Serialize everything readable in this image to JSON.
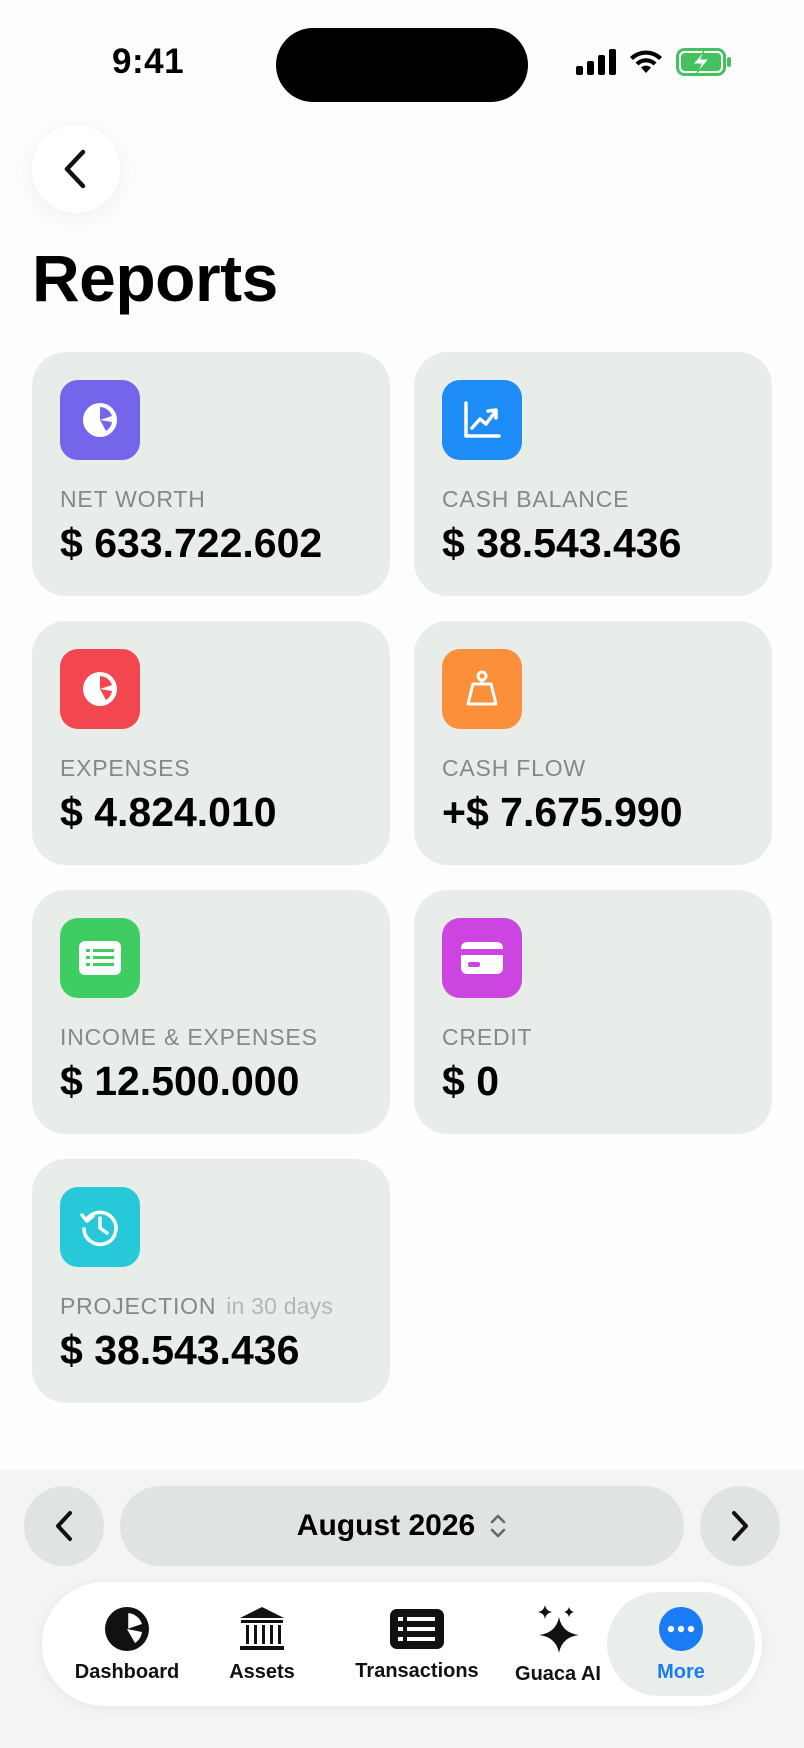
{
  "status_bar": {
    "time": "9:41"
  },
  "header": {
    "title": "Reports"
  },
  "cards": [
    {
      "label": "NET WORTH",
      "value": "$ 633.722.602",
      "icon": "pie-chart-icon",
      "color": "#7466ea"
    },
    {
      "label": "CASH BALANCE",
      "value": "$ 38.543.436",
      "icon": "trend-chart-icon",
      "color": "#1d8cf6"
    },
    {
      "label": "EXPENSES",
      "value": "$ 4.824.010",
      "icon": "pie-chart-icon",
      "color": "#f2474f"
    },
    {
      "label": "CASH FLOW",
      "value": "+$ 7.675.990",
      "icon": "scale-icon",
      "color": "#fb8f3a"
    },
    {
      "label": "INCOME & EXPENSES",
      "value": "$ 12.500.000",
      "icon": "document-icon",
      "color": "#3fcc63"
    },
    {
      "label": "CREDIT",
      "value": "$ 0",
      "icon": "credit-card-icon",
      "color": "#cc45e0"
    },
    {
      "label": "PROJECTION",
      "sublabel": "in 30 days",
      "value": "$ 38.543.436",
      "icon": "history-icon",
      "color": "#27c9d8"
    }
  ],
  "month_selector": {
    "label": "August 2026"
  },
  "tabbar": {
    "active": "More",
    "active_color": "#1a7cf5",
    "items": [
      {
        "label": "Dashboard",
        "icon": "pie-chart-icon"
      },
      {
        "label": "Assets",
        "icon": "bank-icon"
      },
      {
        "label": "Transactions",
        "icon": "list-icon"
      },
      {
        "label": "Guaca AI",
        "icon": "sparkles-icon"
      },
      {
        "label": "More",
        "icon": "more-icon"
      }
    ]
  }
}
